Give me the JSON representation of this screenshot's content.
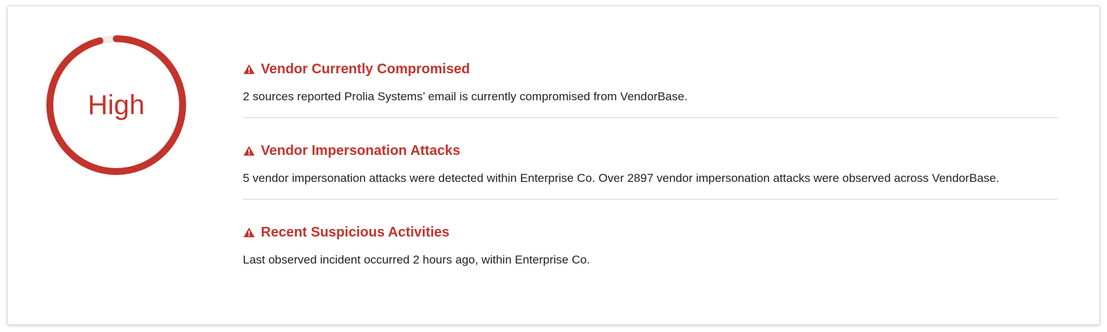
{
  "risk": {
    "level_label": "High",
    "score_fraction": 0.96,
    "accent_color": "#c2342c",
    "track_color": "#eeeeee"
  },
  "findings": [
    {
      "icon": "warning-icon",
      "title": "Vendor Currently Compromised",
      "text": "2 sources reported Prolia Systems’ email is currently compromised from VendorBase."
    },
    {
      "icon": "warning-icon",
      "title": "Vendor Impersonation Attacks",
      "text": "5 vendor impersonation attacks were detected within Enterprise Co. Over 2897 vendor impersonation attacks were observed across VendorBase."
    },
    {
      "icon": "warning-icon",
      "title": "Recent Suspicious Activities",
      "text": "Last observed incident occurred 2 hours ago, within Enterprise Co."
    }
  ]
}
